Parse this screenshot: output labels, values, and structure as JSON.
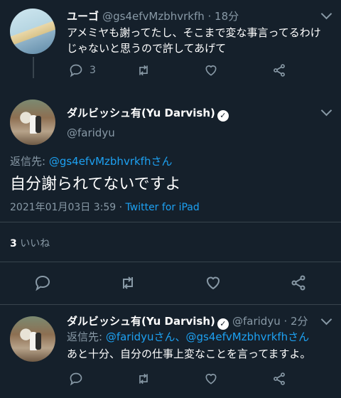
{
  "tweet1": {
    "name": "ユーゴ",
    "handle_time": "@gs4efvMzbhvrkfh · 18分",
    "text_line1": "アメミヤも謝ってたし、そこまで変な事言ってるわけ",
    "text_line2": "じゃないと思うので許してあげて",
    "reply_count": "3"
  },
  "main_tweet": {
    "name": "ダルビッシュ有(Yu Darvish)",
    "handle": "@faridyu",
    "reply_prefix": "返信先: ",
    "reply_to": "@gs4efvMzbhvrkfhさん",
    "text": "自分謝られてないですよ",
    "timestamp": "2021年01月03日 3:59",
    "source_sep": " · ",
    "source": "Twitter for iPad",
    "likes_count": "3",
    "likes_label": "いいね"
  },
  "tweet3": {
    "name": "ダルビッシュ有(Yu Darvish)",
    "handle_time": "@faridyu · 2分",
    "reply_prefix": "返信先: ",
    "reply_to": "@faridyuさん、@gs4efvMzbhvrkfhさん",
    "text": "あと十分、自分の仕事上変なことを言ってますよ。"
  },
  "icons": [
    "reply-icon",
    "retweet-icon",
    "like-icon",
    "share-icon",
    "chevron-down-icon",
    "verified-badge-icon"
  ],
  "colors": {
    "background": "#15202b",
    "link": "#1da1f2",
    "muted": "#8899a6",
    "divider": "#38444d"
  }
}
